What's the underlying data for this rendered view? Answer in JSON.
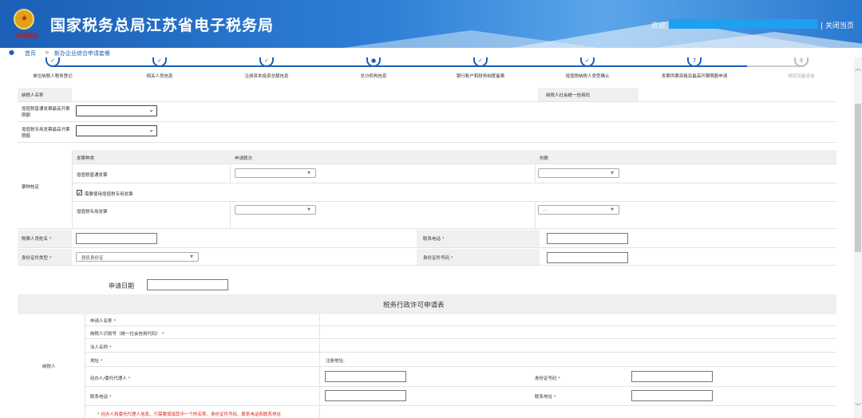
{
  "header": {
    "title": "国家税务总局江苏省电子税务局",
    "logo_text": "中国税务",
    "welcome": "欢迎,",
    "close_link": "| 关闭当页"
  },
  "breadcrumb": {
    "home": "首页",
    "separator": ">",
    "current": "新办企业综合申请套餐"
  },
  "steps": [
    {
      "label": "单位纳税人税务登记",
      "done": true
    },
    {
      "label": "相关人员信息",
      "done": true
    },
    {
      "label": "注册资本投资总额信息",
      "done": true
    },
    {
      "label": "总分机构信息",
      "done": true
    },
    {
      "label": "银行账户和财务制度备案",
      "done": true
    },
    {
      "label": "增值税纳税人类型确认",
      "done": true
    },
    {
      "label": "发票供票资格及最高开票限额申请",
      "num": "7",
      "done": false
    },
    {
      "label": "税控设备咨询",
      "num": "8",
      "done": false
    }
  ],
  "form": {
    "taxpayer_name": "纳税人名称",
    "credit_code": "纳税人社会统一信用码",
    "vat_normal_limit": "增值税普通发票最高开票限额",
    "vat_special_limit": "增值税专用发票最高开票限额",
    "ticket_verify": "票种核定",
    "invoice_type_col": "发票种类",
    "apply_copies_col": "申请联次",
    "count_col": "份数",
    "vat_normal": "增值税普通发票",
    "need_special": "需要使用增值税专用发票",
    "vat_special": "增值税专用发票",
    "special_count_value": "...",
    "buyer_name": "购票人员姓名",
    "contact_phone": "联系电话",
    "id_type": "身份证件类型",
    "id_type_value": "居民身份证",
    "id_number": "身份证件号码",
    "apply_date": "申请日期"
  },
  "license": {
    "section_title": "税务行政许可申请表",
    "taxpayer": "纳税人",
    "applicant_name": "申请人名称",
    "taxpayer_id": "纳税人识别号（统一社会信用代码）",
    "legal_name": "法人名称",
    "address": "地址",
    "registered_address": "注册地址:",
    "agent": "经办人/委托代理人",
    "id_no": "身份证号码",
    "phone": "联系电话",
    "contact_address": "联系地址",
    "note": "* 经办人和委托代理人信息，只需要填填其中一个的名称、身份证件号码、联系电话和联系地址"
  },
  "colors": {
    "primary": "#1c5fb8",
    "required": "#d9281c"
  }
}
